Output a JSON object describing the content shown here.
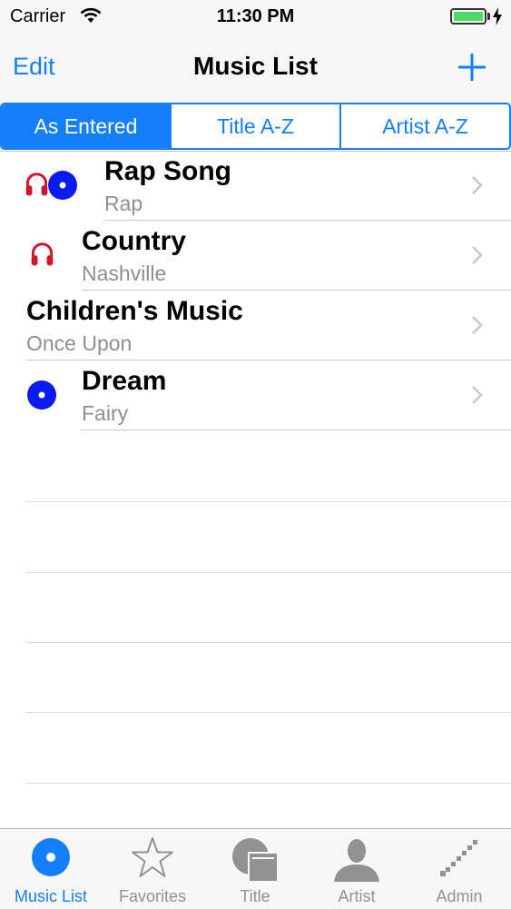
{
  "status_bar": {
    "carrier": "Carrier",
    "time": "11:30 PM"
  },
  "nav": {
    "edit_label": "Edit",
    "title": "Music List",
    "add_icon": "plus-icon"
  },
  "segments": [
    {
      "label": "As Entered",
      "selected": true
    },
    {
      "label": "Title A-Z",
      "selected": false
    },
    {
      "label": "Artist A-Z",
      "selected": false
    }
  ],
  "songs": [
    {
      "title": "Rap Song",
      "subtitle": "Rap",
      "icons": [
        "headphones-icon",
        "disc-icon"
      ]
    },
    {
      "title": "Country",
      "subtitle": "Nashville",
      "icons": [
        "headphones-icon"
      ]
    },
    {
      "title": "Children's Music",
      "subtitle": "Once Upon",
      "icons": []
    },
    {
      "title": "Dream",
      "subtitle": "Fairy",
      "icons": [
        "disc-icon"
      ]
    }
  ],
  "tabs": [
    {
      "label": "Music List",
      "icon": "disc-icon",
      "selected": true
    },
    {
      "label": "Favorites",
      "icon": "star-icon",
      "selected": false
    },
    {
      "label": "Title",
      "icon": "title-icon",
      "selected": false
    },
    {
      "label": "Artist",
      "icon": "person-icon",
      "selected": false
    },
    {
      "label": "Admin",
      "icon": "admin-icon",
      "selected": false
    }
  ],
  "colors": {
    "accent": "#157efb",
    "headphones": "#d0142c",
    "disc": "#0a1bf0",
    "tab_inactive": "#929292"
  }
}
